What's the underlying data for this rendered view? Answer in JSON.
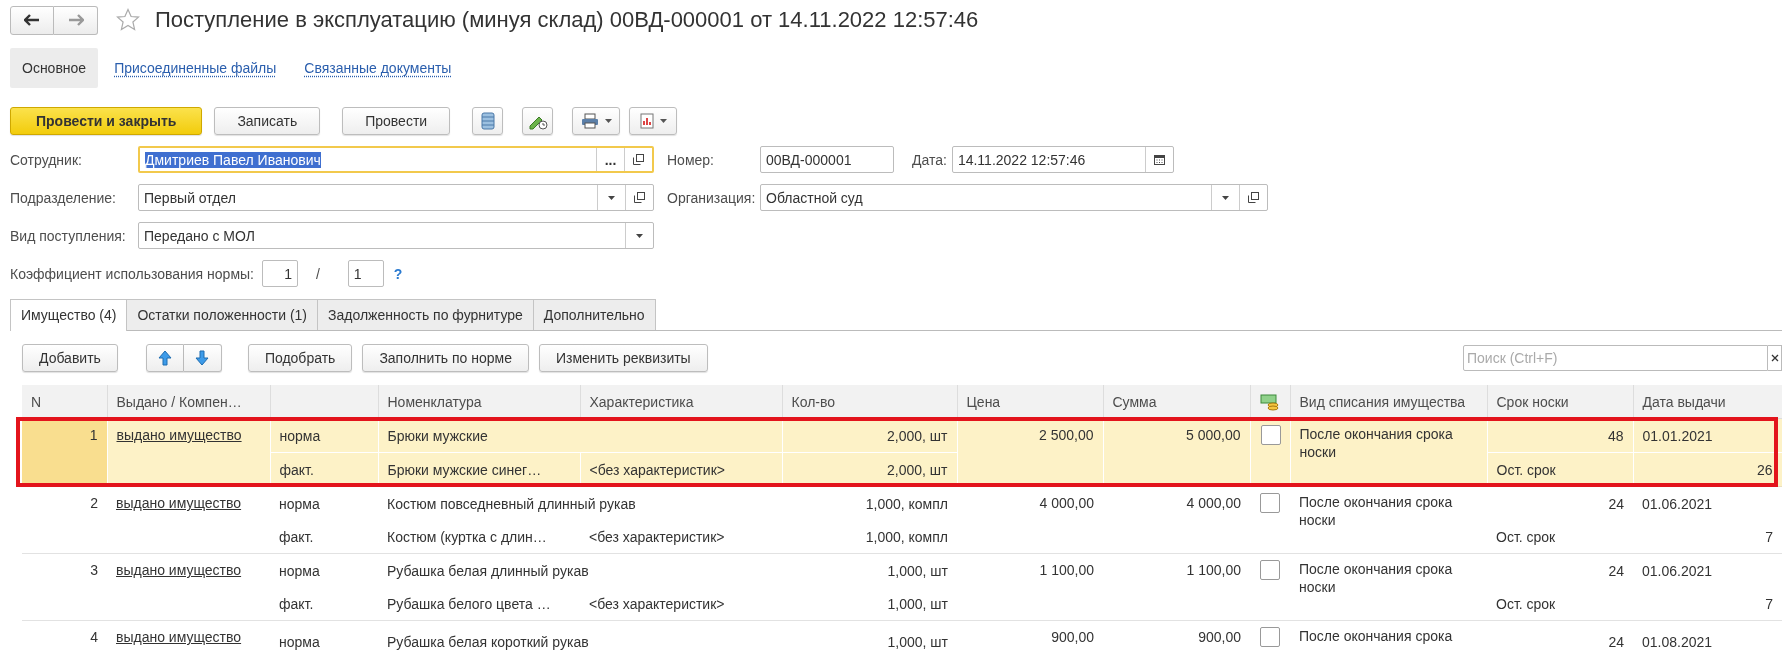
{
  "window": {
    "title": "Поступление в эксплуатацию (минуя склад) 00ВД-000001 от 14.11.2022 12:57:46",
    "favorite": false
  },
  "nav": [
    {
      "label": "Основное",
      "selected": true
    },
    {
      "label": "Присоединенные файлы",
      "selected": false
    },
    {
      "label": "Связанные документы",
      "selected": false
    }
  ],
  "command_bar": {
    "buttons": [
      {
        "label": "Провести и закрыть",
        "kind": "primary"
      },
      {
        "label": "Записать",
        "kind": "plain"
      },
      {
        "label": "Провести",
        "kind": "plain"
      }
    ]
  },
  "employee": {
    "label": "Сотрудник:",
    "value": "Дмитриев Павел Иванович",
    "choose": "...",
    "focused": true
  },
  "number": {
    "label": "Номер:",
    "value": "00ВД-000001"
  },
  "date": {
    "label": "Дата:",
    "value": "14.11.2022 12:57:46"
  },
  "division": {
    "label": "Подразделение:",
    "value": "Первый отдел"
  },
  "organization": {
    "label": "Организация:",
    "value": "Областной суд"
  },
  "receipt_type": {
    "label": "Вид поступления:",
    "value": "Передано с МОЛ"
  },
  "coefficient": {
    "label": "Коэффициент использования нормы:",
    "numerator": "1",
    "separator": "/",
    "denominator": "1",
    "help": "?"
  },
  "tabs": [
    {
      "label": "Имущество (4)",
      "selected": true
    },
    {
      "label": "Остатки положенности (1)",
      "selected": false
    },
    {
      "label": "Задолженность по фурнитуре",
      "selected": false
    },
    {
      "label": "Дополнительно",
      "selected": false
    }
  ],
  "table_toolbar": {
    "buttons": [
      "Добавить",
      "Подобрать",
      "Заполнить по норме",
      "Изменить реквизиты"
    ],
    "search": {
      "placeholder": "Поиск (Ctrl+F)"
    }
  },
  "table": {
    "columns": [
      {
        "kind": "text",
        "label": "N"
      },
      {
        "kind": "text",
        "label": "Выдано / Компен…"
      },
      {
        "kind": "blank"
      },
      {
        "kind": "text",
        "label": "Номенклатура"
      },
      {
        "kind": "text",
        "label": "Характеристика"
      },
      {
        "kind": "text",
        "label": "Кол-во"
      },
      {
        "kind": "text",
        "label": "Цена"
      },
      {
        "kind": "text",
        "label": "Сумма"
      },
      {
        "kind": "icon"
      },
      {
        "kind": "text",
        "label": "Вид списания имущества"
      },
      {
        "kind": "text",
        "label": "Срок носки"
      },
      {
        "kind": "text",
        "label": "Дата выдачи"
      }
    ],
    "rows": [
      {
        "number": "1",
        "issued": "выдано имущество",
        "selected": true,
        "lines": [
          {
            "label": "норма",
            "name": "Брюки мужские",
            "qty": "2,000, шт"
          },
          {
            "label": "факт.",
            "name": "Брюки  мужские синег…",
            "characteristic": "<без характеристик>",
            "qty": "2,000, шт"
          }
        ],
        "price": "2 500,00",
        "sum": "5 000,00",
        "writeoff_checked": false,
        "writeoff": "После окончания срока носки",
        "term": "48",
        "date": "01.01.2021",
        "remaining_label": "Ост. срок",
        "remaining": "26"
      },
      {
        "number": "2",
        "issued": "выдано имущество",
        "selected": false,
        "lines": [
          {
            "label": "норма",
            "name": "Костюм повседневный длинный рукав",
            "qty": "1,000, компл"
          },
          {
            "label": "факт.",
            "name": "Костюм (куртка с длин…",
            "characteristic": "<без характеристик>",
            "qty": "1,000, компл"
          }
        ],
        "price": "4 000,00",
        "sum": "4 000,00",
        "writeoff_checked": false,
        "writeoff": "После окончания срока носки",
        "term": "24",
        "date": "01.06.2021",
        "remaining_label": "Ост. срок",
        "remaining": "7"
      },
      {
        "number": "3",
        "issued": "выдано имущество",
        "selected": false,
        "lines": [
          {
            "label": "норма",
            "name": "Рубашка белая длинный рукав",
            "qty": "1,000, шт"
          },
          {
            "label": "факт.",
            "name": "Рубашка белого цвета …",
            "characteristic": "<без характеристик>",
            "qty": "1,000, шт"
          }
        ],
        "price": "1 100,00",
        "sum": "1 100,00",
        "writeoff_checked": false,
        "writeoff": "После окончания срока носки",
        "term": "24",
        "date": "01.06.2021",
        "remaining_label": "Ост. срок",
        "remaining": "7"
      },
      {
        "number": "4",
        "issued": "выдано имущество",
        "selected": false,
        "lines": [
          {
            "label": "норма",
            "name": "Рубашка белая короткий рукав",
            "qty": "1,000, шт"
          }
        ],
        "price": "900,00",
        "sum": "900,00",
        "writeoff_checked": false,
        "writeoff": "После окончания срока",
        "term": "24",
        "date": "01.08.2021"
      }
    ]
  }
}
